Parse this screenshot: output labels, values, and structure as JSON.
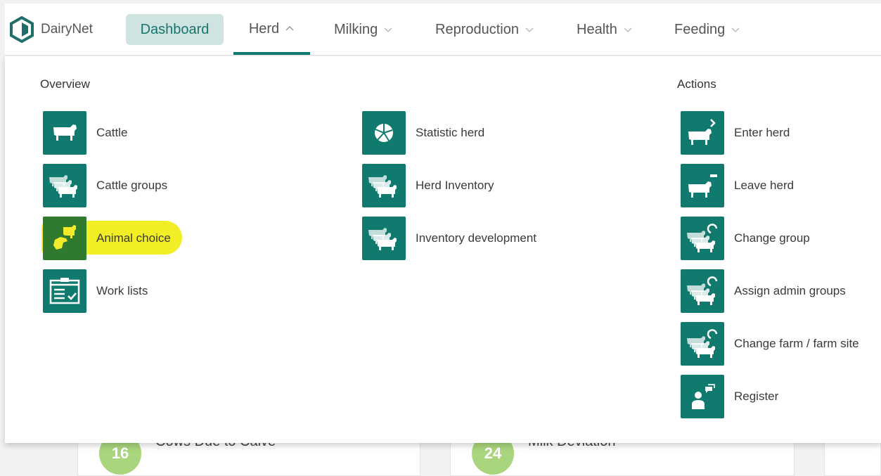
{
  "brand": {
    "name": "DairyNet"
  },
  "nav": {
    "dashboard": "Dashboard",
    "herd": "Herd",
    "milking": "Milking",
    "reproduction": "Reproduction",
    "health": "Health",
    "feeding": "Feeding"
  },
  "menu": {
    "overview_heading": "Overview",
    "actions_heading": "Actions",
    "overview": [
      {
        "label": "Cattle",
        "icon": "cow-icon"
      },
      {
        "label": "Cattle groups",
        "icon": "cattle-group-icon"
      },
      {
        "label": "Animal choice",
        "icon": "hand-cow-icon",
        "highlighted": true
      },
      {
        "label": "Work lists",
        "icon": "clipboard-icon"
      }
    ],
    "middle": [
      {
        "label": "Statistic herd",
        "icon": "pie-chart-icon"
      },
      {
        "label": "Herd Inventory",
        "icon": "cattle-group-icon"
      },
      {
        "label": "Inventory development",
        "icon": "cattle-group-icon"
      }
    ],
    "actions": [
      {
        "label": "Enter herd",
        "icon": "cow-enter-icon"
      },
      {
        "label": "Leave herd",
        "icon": "cow-leave-icon"
      },
      {
        "label": "Change group",
        "icon": "cattle-group-change-icon"
      },
      {
        "label": "Assign admin groups",
        "icon": "cattle-group-change-icon"
      },
      {
        "label": "Change farm / farm site",
        "icon": "cattle-group-change-icon"
      },
      {
        "label": "Register",
        "icon": "person-register-icon"
      }
    ]
  },
  "background_cards": [
    {
      "value": "16",
      "label": "Cows Due to Calve"
    },
    {
      "value": "24",
      "label": "Milk Deviation"
    }
  ],
  "colors": {
    "accent": "#117a6e",
    "dashboard_bg": "#cfe3e1",
    "highlight": "#f0eb00",
    "card_circle": "#a9d57c"
  }
}
